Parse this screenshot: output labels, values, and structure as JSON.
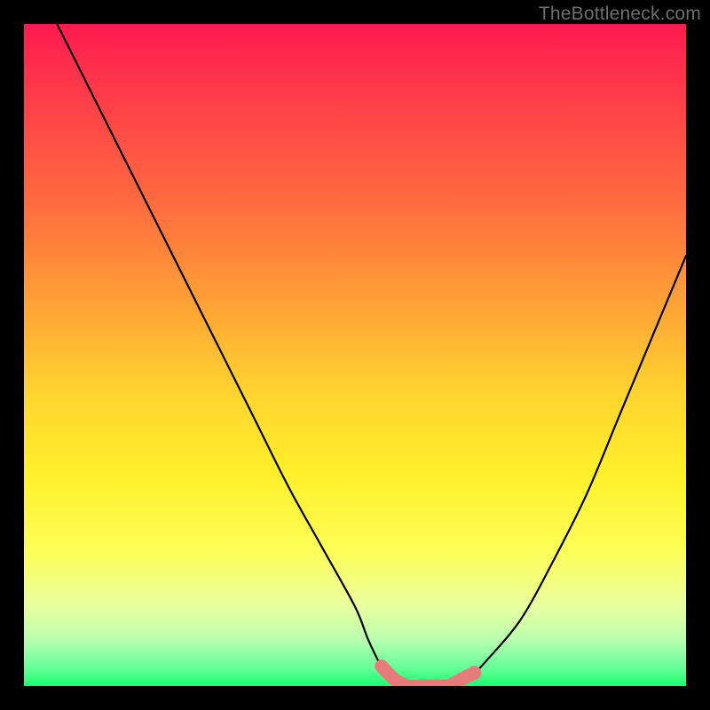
{
  "watermark": {
    "text": "TheBottleneck.com"
  },
  "chart_data": {
    "type": "line",
    "title": "",
    "xlabel": "",
    "ylabel": "",
    "xlim": [
      0,
      100
    ],
    "ylim": [
      0,
      100
    ],
    "grid": false,
    "legend": null,
    "series": [
      {
        "name": "bottleneck-curve",
        "x": [
          5,
          10,
          15,
          20,
          25,
          30,
          35,
          40,
          45,
          50,
          52,
          54,
          56,
          58,
          60,
          62,
          64,
          66,
          68,
          70,
          75,
          80,
          85,
          90,
          95,
          100
        ],
        "values": [
          100,
          90,
          80,
          70,
          60,
          50,
          40,
          30,
          21,
          12,
          7,
          3,
          1,
          0,
          0,
          0,
          0,
          1,
          2,
          4,
          10,
          19,
          29,
          41,
          53,
          65
        ]
      },
      {
        "name": "highlight-band",
        "x": [
          54,
          56,
          58,
          60,
          62,
          64,
          66,
          68
        ],
        "values": [
          3,
          1,
          0,
          0,
          0,
          0,
          1,
          2
        ]
      }
    ],
    "highlight_color": "#e77a7a",
    "curve_color": "#000000",
    "background_gradient": [
      {
        "pos": 0,
        "color": "#ff1a4f"
      },
      {
        "pos": 28,
        "color": "#ff6e3e"
      },
      {
        "pos": 55,
        "color": "#ffd22f"
      },
      {
        "pos": 80,
        "color": "#fdff5a"
      },
      {
        "pos": 97,
        "color": "#6bff9a"
      },
      {
        "pos": 100,
        "color": "#1bff6f"
      }
    ]
  }
}
